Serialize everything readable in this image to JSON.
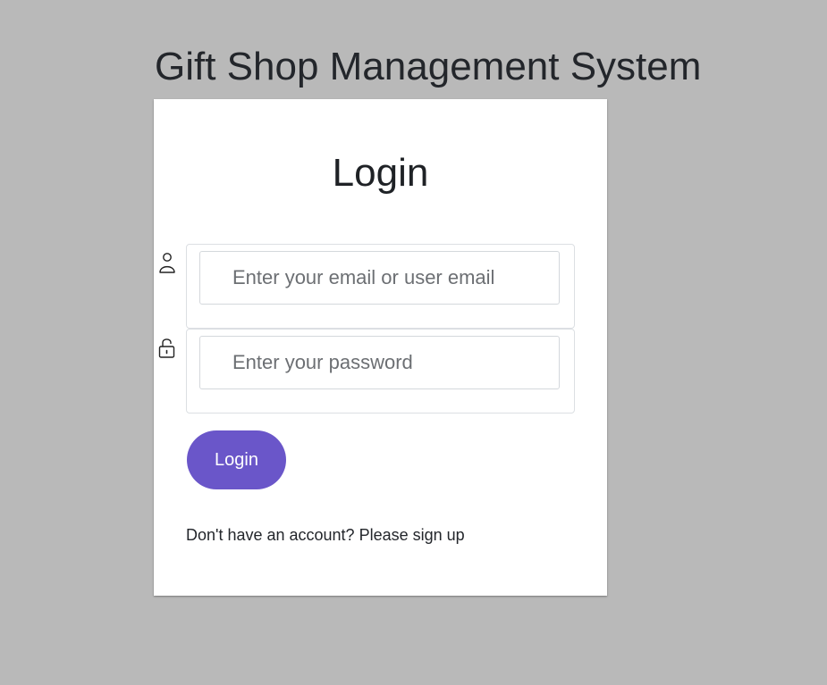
{
  "app": {
    "title": "Gift Shop Management System"
  },
  "login_card": {
    "title": "Login",
    "email_field": {
      "placeholder": "Enter your email or user email",
      "value": "",
      "icon": "user-icon"
    },
    "password_field": {
      "placeholder": "Enter your password",
      "value": "",
      "icon": "lock-icon"
    },
    "submit_label": "Login",
    "signup_prompt": "Don't have an account?",
    "signup_link": "Please sign up"
  },
  "colors": {
    "background": "#b9b9b9",
    "card": "#ffffff",
    "accent": "#6a56c9",
    "text": "#23262b"
  }
}
